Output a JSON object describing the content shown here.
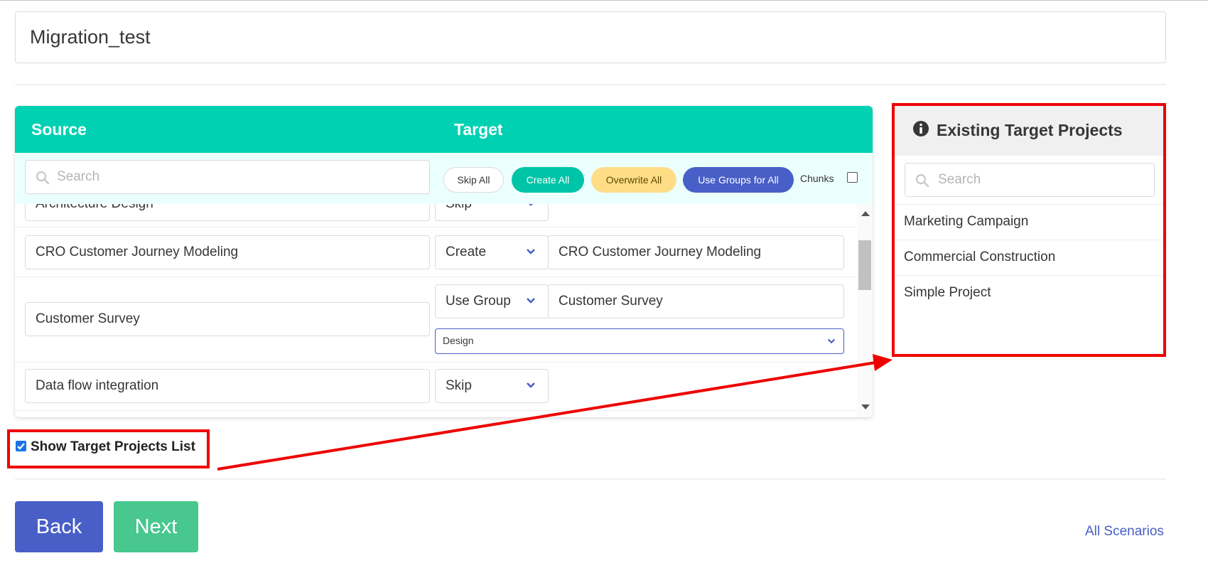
{
  "scenario": {
    "name": "Migration_test"
  },
  "colors": {
    "header": "#00d1b2",
    "primary": "#485fc7",
    "success": "#48c78e",
    "warning": "#ffdd87",
    "annotation": "#ee0000"
  },
  "mapping": {
    "header": {
      "source": "Source",
      "target": "Target"
    },
    "search": {
      "placeholder": "Search",
      "icon": "search-icon"
    },
    "bulk": {
      "skip_all": "Skip All",
      "create_all": "Create All",
      "overwrite_all": "Overwrite All",
      "use_groups_all": "Use Groups for All",
      "chunks": "Chunks"
    },
    "rows": [
      {
        "source": "Architecture Design",
        "action": "Skip",
        "target": ""
      },
      {
        "source": "CRO Customer Journey Modeling",
        "action": "Create",
        "target": "CRO Customer Journey Modeling"
      },
      {
        "source": "Customer Survey",
        "action": "Use Group",
        "target": "Customer Survey",
        "group": "Design"
      },
      {
        "source": "Data flow integration",
        "action": "Skip",
        "target": ""
      }
    ]
  },
  "target_panel": {
    "title": "Existing Target Projects",
    "icon": "info-circle-icon",
    "search_placeholder": "Search",
    "projects": [
      "Marketing Campaign",
      "Commercial Construction",
      "Simple Project"
    ]
  },
  "show_target_list": {
    "label": "Show Target Projects List",
    "checked": true
  },
  "footer": {
    "back": "Back",
    "next": "Next",
    "all_scenarios": "All Scenarios"
  }
}
